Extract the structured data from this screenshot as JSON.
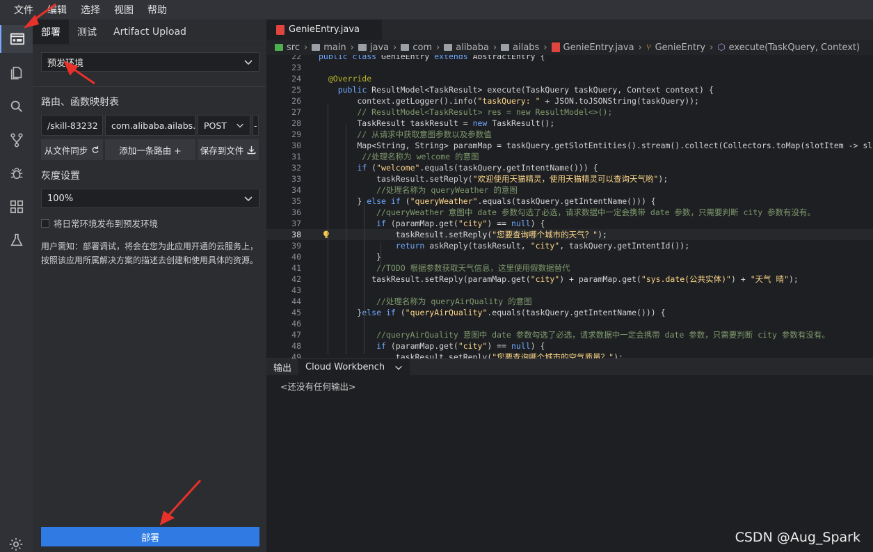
{
  "menu": [
    "文件",
    "编辑",
    "选择",
    "视图",
    "帮助"
  ],
  "activity_icons": [
    "deploy-icon",
    "files-icon",
    "search-icon",
    "git-branch-icon",
    "debug-bug-icon",
    "extensions-grid-icon",
    "flask-test-icon"
  ],
  "panel": {
    "tabs": [
      "部署",
      "测试",
      "Artifact Upload"
    ],
    "env_select": "预发环境",
    "routes_title": "路由、函数映射表",
    "route": {
      "path": "/skill-83232",
      "handler": "com.alibaba.ailabs.(",
      "method": "POST",
      "more": "-"
    },
    "buttons": {
      "sync": "从文件同步",
      "add": "添加一条路由 +",
      "save": "保存到文件"
    },
    "gray_title": "灰度设置",
    "gray_value": "100%",
    "checkbox_label": "将日常环境发布到预发环境",
    "notice": "用户需知：部署调试，将会在您为此应用开通的云服务上，按照该应用所属解决方案的描述去创建和使用具体的资源。",
    "deploy_button": "部署"
  },
  "editor": {
    "tab": "GenieEntry.java",
    "breadcrumb": [
      "src",
      "main",
      "java",
      "com",
      "alibaba",
      "ailabs",
      "GenieEntry.java",
      "GenieEntry",
      "execute(TaskQuery, Context)"
    ],
    "current_line": "38",
    "lines": [
      {
        "n": "22",
        "t": "public class GenieEntry extends AbstractEntry {"
      },
      {
        "n": "23",
        "t": ""
      },
      {
        "n": "24",
        "t": "  @Override"
      },
      {
        "n": "25",
        "t": "    public ResultModel<TaskResult> execute(TaskQuery taskQuery, Context context) {"
      },
      {
        "n": "26",
        "t": "        context.getLogger().info(\"taskQuery: \" + JSON.toJSONString(taskQuery));"
      },
      {
        "n": "27",
        "t": "        // ResultModel<TaskResult> res = new ResultModel<>();"
      },
      {
        "n": "28",
        "t": "        TaskResult taskResult = new TaskResult();"
      },
      {
        "n": "29",
        "t": "        // 从请求中获取意图参数以及参数值"
      },
      {
        "n": "30",
        "t": "        Map<String, String> paramMap = taskQuery.getSlotEntities().stream().collect(Collectors.toMap(slotItem -> slotItem"
      },
      {
        "n": "31",
        "t": "         //处理名称为 welcome 的意图"
      },
      {
        "n": "32",
        "t": "        if (\"welcome\".equals(taskQuery.getIntentName())) {"
      },
      {
        "n": "33",
        "t": "            taskResult.setReply(\"欢迎使用天猫精灵，使用天猫精灵可以查询天气哟\");"
      },
      {
        "n": "34",
        "t": "            //处理名称为 queryWeather 的意图"
      },
      {
        "n": "35",
        "t": "        } else if (\"queryWeather\".equals(taskQuery.getIntentName())) {"
      },
      {
        "n": "36",
        "t": "            //queryWeather 意图中 date 参数勾选了必选，请求数据中一定会携带 date 参数，只需要判断 city 参数有没有。"
      },
      {
        "n": "37",
        "t": "            if (paramMap.get(\"city\") == null) {"
      },
      {
        "n": "38",
        "t": "                taskResult.setReply(\"您要查询哪个城市的天气？\");"
      },
      {
        "n": "39",
        "t": "                return askReply(taskResult, \"city\", taskQuery.getIntentId());"
      },
      {
        "n": "40",
        "t": "            }"
      },
      {
        "n": "41",
        "t": "            //TODO 根据参数获取天气信息，这里使用假数据替代"
      },
      {
        "n": "42",
        "t": "           taskResult.setReply(paramMap.get(\"city\") + paramMap.get(\"sys.date(公共实体)\") + \"天气 晴\");"
      },
      {
        "n": "43",
        "t": ""
      },
      {
        "n": "44",
        "t": "            //处理名称为 queryAirQuality 的意图"
      },
      {
        "n": "45",
        "t": "        }else if (\"queryAirQuality\".equals(taskQuery.getIntentName())) {"
      },
      {
        "n": "46",
        "t": ""
      },
      {
        "n": "47",
        "t": "            //queryAirQuality 意图中 date 参数勾选了必选，请求数据中一定会携带 date 参数，只需要判断 city 参数有没有。"
      },
      {
        "n": "48",
        "t": "            if (paramMap.get(\"city\") == null) {"
      },
      {
        "n": "49",
        "t": "                taskResult.setReply(\"您要查询哪个城市的空气质量？\");"
      }
    ]
  },
  "output": {
    "tabs": [
      "输出",
      "Cloud Workbench"
    ],
    "empty": "<还没有任何输出>"
  },
  "watermark": "CSDN @Aug_Spark",
  "colors": {
    "accent": "#2f7be3",
    "annotation_arrow": "#e8312a"
  }
}
